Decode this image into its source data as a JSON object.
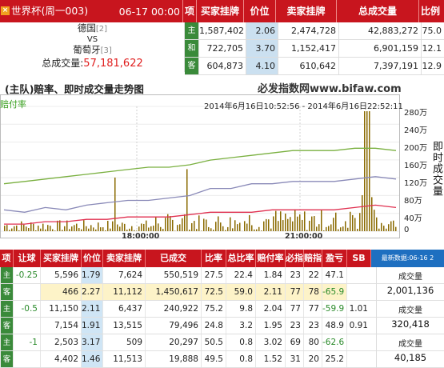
{
  "match": {
    "name": "世界杯(周一003)",
    "datetime": "06-17 00:00",
    "home": "德国",
    "home_rank": "[2]",
    "vs": "VS",
    "away": "葡萄牙",
    "away_rank": "[3]",
    "total_label": "总成交量:",
    "total_value": "57,181,622"
  },
  "top_table": {
    "headers": [
      "项",
      "买家挂牌",
      "价位",
      "卖家挂牌",
      "总成交量",
      "比例"
    ],
    "rows": [
      {
        "label": "主",
        "buy": "1,587,402",
        "price": "2.06",
        "sell": "2,474,728",
        "volume": "42,883,272",
        "ratio": "75.0"
      },
      {
        "label": "和",
        "buy": "722,705",
        "price": "3.70",
        "sell": "1,152,417",
        "volume": "6,901,159",
        "ratio": "12.1"
      },
      {
        "label": "客",
        "buy": "604,873",
        "price": "4.10",
        "sell": "610,642",
        "volume": "7,397,191",
        "ratio": "12.9"
      }
    ]
  },
  "chart_data": {
    "type": "line",
    "title": "(主队)赔率、即时成交量走势图",
    "site": "必发指数网www.bifaw.com",
    "legend": "赔付率",
    "date_range": "2014年6月16日10:52:56 - 2014年6月16日22:52:11",
    "x_ticks": [
      "18:00:00",
      "21:00:00"
    ],
    "y_ticks": [
      "280万",
      "240万",
      "200万",
      "160万",
      "120万",
      "80万",
      "40万",
      "0"
    ],
    "ylabel": "即时成交量",
    "ylim": [
      0,
      2800000
    ],
    "series": [
      {
        "color": "#7ab040",
        "values": [
          0.2,
          0.21,
          0.22,
          0.23,
          0.24,
          0.25,
          0.26,
          0.27,
          0.27,
          0.28,
          0.3,
          0.31,
          0.32,
          0.33,
          0.34,
          0.34,
          0.34,
          0.35,
          0.35,
          0.34
        ]
      },
      {
        "color": "#8a8ab8",
        "values": [
          0.09,
          0.08,
          0.1,
          0.09,
          0.11,
          0.12,
          0.13,
          0.13,
          0.14,
          0.15,
          0.18,
          0.18,
          0.2,
          0.2,
          0.21,
          0.21,
          0.21,
          0.22,
          0.23,
          0.22
        ]
      },
      {
        "color": "#e03050",
        "values": [
          0.03,
          0.03,
          0.04,
          0.04,
          0.05,
          0.05,
          0.06,
          0.06,
          0.06,
          0.07,
          0.08,
          0.08,
          0.08,
          0.09,
          0.09,
          0.09,
          0.09,
          0.1,
          0.11,
          0.1
        ]
      }
    ],
    "volume_bars_color": "#8a6a00"
  },
  "bottom_table": {
    "headers": [
      "项",
      "让球",
      "买家挂牌",
      "价位",
      "卖家挂牌",
      "已成交",
      "比率",
      "总比率",
      "赔付率",
      "必指",
      "赔指",
      "盈亏",
      "SB",
      "最新数据:06-16 2"
    ],
    "groups": [
      {
        "handicap": "-0.25",
        "volume_label": "成交量",
        "volume": "2,001,136",
        "rows": [
          {
            "label": "主",
            "buy": "5,596",
            "price": "1.79",
            "sell": "7,624",
            "done": "550,519",
            "rate": "27.5",
            "total": "22.4",
            "payout": "1.84",
            "bizhi": "23",
            "peizhi": "22",
            "pnl": "47.1",
            "sb": ""
          },
          {
            "label": "客",
            "buy": "466",
            "price": "2.27",
            "sell": "11,112",
            "done": "1,450,617",
            "rate": "72.5",
            "total": "59.0",
            "payout": "2.11",
            "bizhi": "77",
            "peizhi": "78",
            "pnl": "-65.9",
            "sb": ""
          }
        ]
      },
      {
        "handicap": "-0.5",
        "volume_label": "成交量",
        "volume": "320,418",
        "rows": [
          {
            "label": "主",
            "buy": "11,150",
            "price": "2.11",
            "sell": "6,437",
            "done": "240,922",
            "rate": "75.2",
            "total": "9.8",
            "payout": "2.04",
            "bizhi": "77",
            "peizhi": "77",
            "pnl": "-59.9",
            "sb": "1.01"
          },
          {
            "label": "客",
            "buy": "7,154",
            "price": "1.91",
            "sell": "13,515",
            "done": "79,496",
            "rate": "24.8",
            "total": "3.2",
            "payout": "1.95",
            "bizhi": "23",
            "peizhi": "23",
            "pnl": "48.9",
            "sb": "0.91"
          }
        ]
      },
      {
        "handicap": "-1",
        "volume_label": "成交量",
        "volume": "40,185",
        "rows": [
          {
            "label": "主",
            "buy": "2,503",
            "price": "3.17",
            "sell": "509",
            "done": "20,297",
            "rate": "50.5",
            "total": "0.8",
            "payout": "3.02",
            "bizhi": "69",
            "peizhi": "80",
            "pnl": "-62.6",
            "sb": ""
          },
          {
            "label": "客",
            "buy": "4,402",
            "price": "1.46",
            "sell": "11,513",
            "done": "19,888",
            "rate": "49.5",
            "total": "0.8",
            "payout": "1.52",
            "bizhi": "31",
            "peizhi": "20",
            "pnl": "25.2",
            "sb": ""
          }
        ]
      }
    ]
  }
}
